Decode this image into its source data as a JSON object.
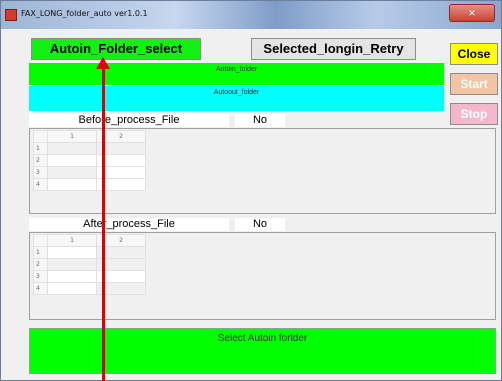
{
  "window": {
    "title": "FAX_LONG_folder_auto  ver1.0.1"
  },
  "buttons": {
    "autoin_folder_select": "Autoin_Folder_select",
    "selected_login_retry": "Selected_longin_Retry",
    "close": "Close",
    "start": "Start",
    "stop": "Stop"
  },
  "bars": {
    "autoin_folder": "Autoin_folder",
    "autoout_folder": "Autoout_folder"
  },
  "before": {
    "label": "Before_process_File",
    "count_label": "No",
    "columns": [
      "1",
      "2"
    ],
    "rows": [
      "1",
      "2",
      "3",
      "4"
    ]
  },
  "after": {
    "label": "After_process_File",
    "count_label": "No",
    "columns": [
      "1",
      "2"
    ],
    "rows": [
      "1",
      "2",
      "3",
      "4"
    ]
  },
  "status": {
    "message": "Select Autoin forlder"
  },
  "colors": {
    "autoin_button": "#14f014",
    "autoin_bar": "#00ff00",
    "autoout_bar": "#00ffff",
    "close_button": "#ffff00",
    "start_button": "#f2c4a3",
    "stop_button": "#f4b8cc",
    "status_bar": "#00ff00",
    "annotation_arrow": "#e00000"
  }
}
